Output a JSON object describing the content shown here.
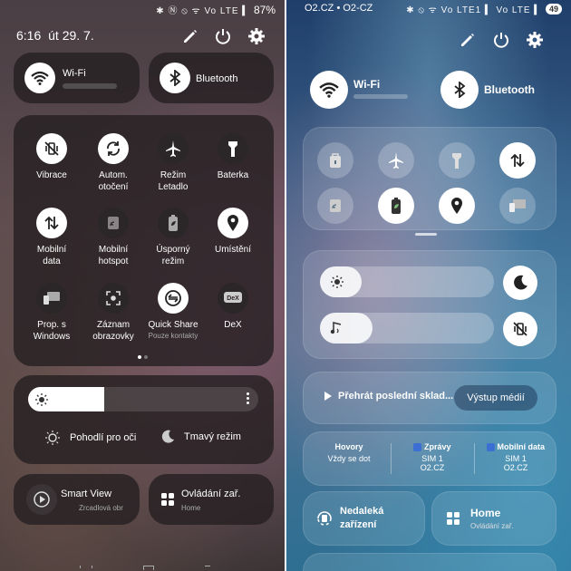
{
  "left": {
    "status": {
      "time": "6:16",
      "date": "út 29. 7.",
      "icons": "✱ Ⓝ ⦸ ᯤ Vo LTE ▍",
      "battery": "87%"
    },
    "header_icons": [
      "edit-icon",
      "power-icon",
      "settings-icon"
    ],
    "wifi": {
      "label": "Wi-Fi"
    },
    "bluetooth": {
      "label": "Bluetooth"
    },
    "tiles": [
      {
        "label": "Vibrace",
        "icon": "vibrate-off-icon",
        "active": true
      },
      {
        "label": "Autom.\notočení",
        "icon": "auto-rotate-icon",
        "active": true
      },
      {
        "label": "Režim\nLetadlo",
        "icon": "airplane-icon",
        "active": false
      },
      {
        "label": "Baterka",
        "icon": "flashlight-icon",
        "active": false
      },
      {
        "label": "Mobilní\ndata",
        "icon": "mobile-data-icon",
        "active": true
      },
      {
        "label": "Mobilní\nhotspot",
        "icon": "hotspot-icon",
        "active": false
      },
      {
        "label": "Úsporný\nrežim",
        "icon": "power-saving-icon",
        "active": false
      },
      {
        "label": "Umístění",
        "icon": "location-icon",
        "active": true
      },
      {
        "label": "Prop. s\nWindows",
        "icon": "link-to-windows-icon",
        "active": false
      },
      {
        "label": "Záznam\nobrazovky",
        "icon": "screen-record-icon",
        "active": false
      },
      {
        "label": "Quick Share",
        "sub": "Pouze kontakty",
        "icon": "quick-share-icon",
        "active": true
      },
      {
        "label": "DeX",
        "icon": "dex-icon",
        "active": false
      }
    ],
    "brightness": {
      "level": 0.33
    },
    "eye_comfort": "Pohodlí pro oči",
    "dark_mode": "Tmavý režim",
    "smart_view": {
      "title": "Smart View",
      "sub": "Zrcadlová obr"
    },
    "device_control": {
      "title": "Ovládání zař.",
      "sub": "Home"
    }
  },
  "right": {
    "status": {
      "carrier": "O2.CZ • O2-CZ",
      "icons": "✱ ⦸ ᯤ Vo LTE1 ▍ Vo LTE ▍",
      "battery": "49"
    },
    "header_icons": [
      "edit-icon",
      "power-icon",
      "settings-icon"
    ],
    "wifi": {
      "label": "Wi-Fi"
    },
    "bluetooth": {
      "label": "Bluetooth"
    },
    "media": {
      "play_label": "Přehrát poslední sklad...",
      "output_label": "Výstup médií"
    },
    "sim": {
      "calls": {
        "title": "Hovory",
        "value": "Vždy se dot"
      },
      "messages": {
        "title": "Zprávy",
        "sim": "SIM 1",
        "carrier": "O2.CZ"
      },
      "data": {
        "title": "Mobilní data",
        "sim": "SIM 1",
        "carrier": "O2.CZ"
      }
    },
    "nearby": {
      "title": "Nedaleká\nzařízení"
    },
    "home": {
      "title": "Home",
      "sub": "Ovládání zař."
    },
    "brightness": {
      "level": 0.24
    },
    "volume": {
      "level": 0.3
    }
  },
  "colors": {
    "accent_white": "#ffffff",
    "dark_tile": "#2b2628"
  }
}
